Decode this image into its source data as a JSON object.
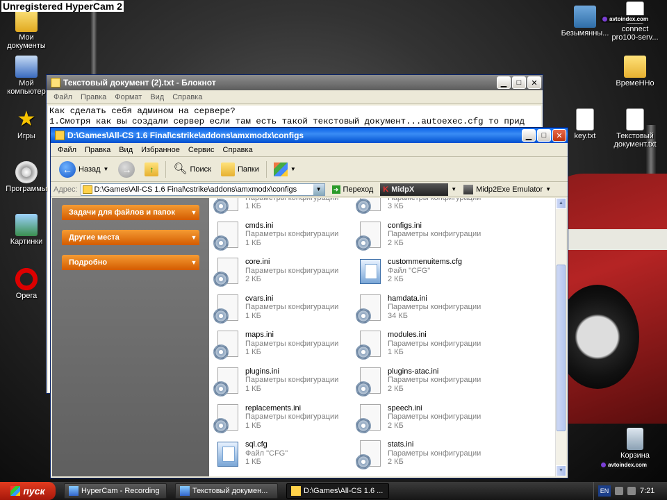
{
  "watermark": "Unregistered HyperCam 2",
  "desktop": {
    "left_icons": [
      {
        "label": "Мои документы",
        "icon": "my-documents-icon"
      },
      {
        "label": "Мой компьютер",
        "icon": "my-computer-icon"
      },
      {
        "label": "Игры",
        "icon": "games-star-icon"
      },
      {
        "label": "Программы",
        "icon": "programs-cd-icon"
      },
      {
        "label": "Картинки",
        "icon": "pictures-icon"
      },
      {
        "label": "Opera",
        "icon": "opera-icon"
      }
    ],
    "right_icons": [
      {
        "label": "Безымянны...",
        "icon": "image-file-icon"
      },
      {
        "label": "connect pro100-serv...",
        "icon": "text-file-icon"
      },
      {
        "label": "ВремеННо",
        "icon": "folder-icon"
      },
      {
        "label": "key.txt",
        "icon": "text-file-icon"
      },
      {
        "label": "Текстовый документ.txt",
        "icon": "text-file-icon"
      },
      {
        "label": "Корзина",
        "icon": "recycle-bin-icon"
      }
    ],
    "badges": [
      "avtoindex.com",
      "avtoindex.com"
    ]
  },
  "notepad": {
    "title": "Текстовый документ (2).txt - Блокнот",
    "menu": [
      "Файл",
      "Правка",
      "Формат",
      "Вид",
      "Справка"
    ],
    "lines": [
      "Как сделать себя админом на сервере?",
      "1.Смотря как вы создали сервер если там есть такой текстовый документ...autoexec.cfg то прид"
    ]
  },
  "explorer": {
    "title": "D:\\Games\\All-CS 1.6 Final\\cstrike\\addons\\amxmodx\\configs",
    "menu": [
      "Файл",
      "Правка",
      "Вид",
      "Избранное",
      "Сервис",
      "Справка"
    ],
    "toolbar": {
      "back": "Назад",
      "search": "Поиск",
      "folders": "Папки"
    },
    "address": {
      "label": "Адрес:",
      "value": "D:\\Games\\All-CS 1.6 Final\\cstrike\\addons\\amxmodx\\configs",
      "go": "Переход",
      "midpx": "MidpX",
      "emulator": "Midp2Exe Emulator"
    },
    "tasks": [
      "Задачи для файлов и папок",
      "Другие места",
      "Подробно"
    ],
    "files": [
      {
        "name": "",
        "type": "Параметры конфигурации",
        "size": "1 КБ",
        "kind": "ini"
      },
      {
        "name": "",
        "type": "Параметры конфигурации",
        "size": "3 КБ",
        "kind": "ini"
      },
      {
        "name": "cmds.ini",
        "type": "Параметры конфигурации",
        "size": "1 КБ",
        "kind": "ini"
      },
      {
        "name": "configs.ini",
        "type": "Параметры конфигурации",
        "size": "2 КБ",
        "kind": "ini"
      },
      {
        "name": "core.ini",
        "type": "Параметры конфигурации",
        "size": "2 КБ",
        "kind": "ini"
      },
      {
        "name": "custommenuitems.cfg",
        "type": "Файл \"CFG\"",
        "size": "2 КБ",
        "kind": "cfg"
      },
      {
        "name": "cvars.ini",
        "type": "Параметры конфигурации",
        "size": "1 КБ",
        "kind": "ini"
      },
      {
        "name": "hamdata.ini",
        "type": "Параметры конфигурации",
        "size": "34 КБ",
        "kind": "ini"
      },
      {
        "name": "maps.ini",
        "type": "Параметры конфигурации",
        "size": "1 КБ",
        "kind": "ini"
      },
      {
        "name": "modules.ini",
        "type": "Параметры конфигурации",
        "size": "1 КБ",
        "kind": "ini"
      },
      {
        "name": "plugins.ini",
        "type": "Параметры конфигурации",
        "size": "1 КБ",
        "kind": "ini"
      },
      {
        "name": "plugins-atac.ini",
        "type": "Параметры конфигурации",
        "size": "2 КБ",
        "kind": "ini"
      },
      {
        "name": "replacements.ini",
        "type": "Параметры конфигурации",
        "size": "1 КБ",
        "kind": "ini"
      },
      {
        "name": "speech.ini",
        "type": "Параметры конфигурации",
        "size": "2 КБ",
        "kind": "ini"
      },
      {
        "name": "sql.cfg",
        "type": "Файл \"CFG\"",
        "size": "1 КБ",
        "kind": "cfg"
      },
      {
        "name": "stats.ini",
        "type": "Параметры конфигурации",
        "size": "2 КБ",
        "kind": "ini"
      }
    ]
  },
  "taskbar": {
    "start": "пуск",
    "buttons": [
      "HyperCam - Recording",
      "Текстовый докумен...",
      "D:\\Games\\All-CS 1.6 ..."
    ],
    "lang": "EN",
    "clock": "7:21"
  }
}
